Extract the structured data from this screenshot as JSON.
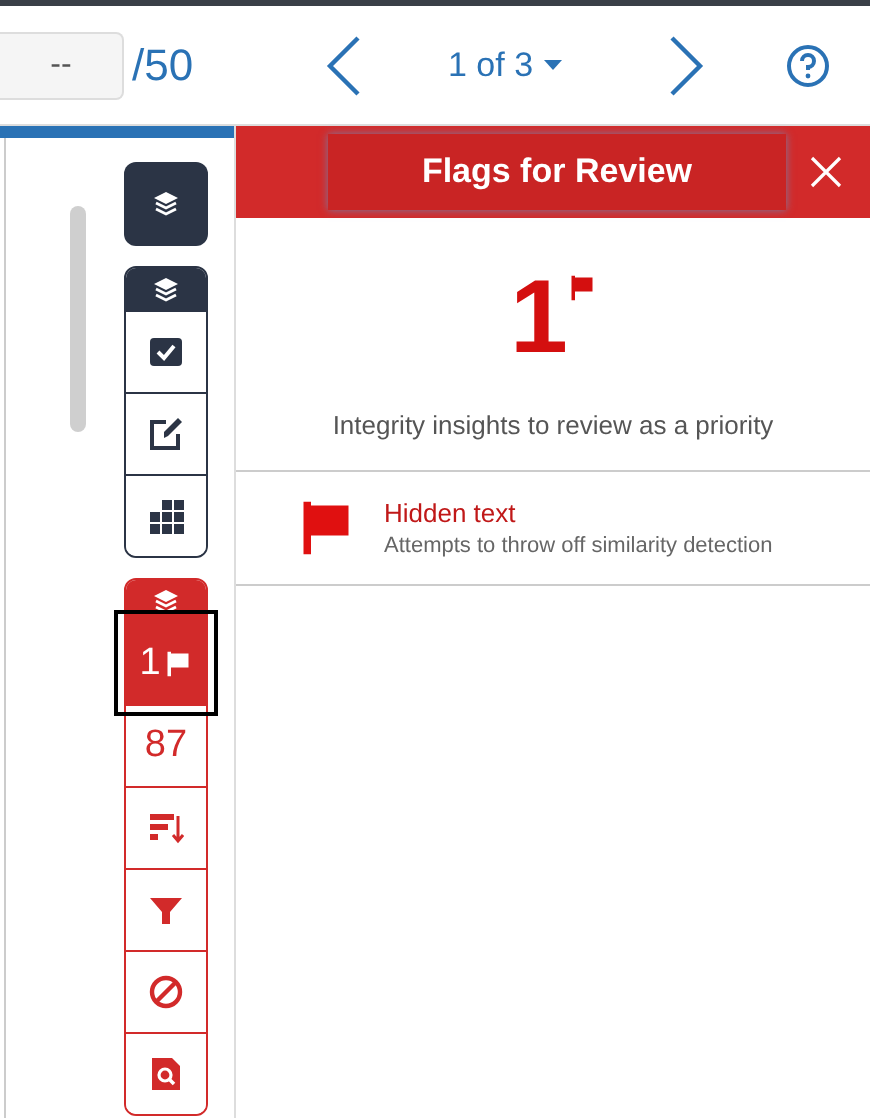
{
  "toolbar": {
    "page_field": {
      "value": "--"
    },
    "page_total": "/50",
    "pager": "1 of 3"
  },
  "rail": {
    "groups": [
      {
        "color": "#2b3445",
        "items": [
          {
            "kind": "check",
            "selected": false
          },
          {
            "kind": "edit",
            "selected": false
          },
          {
            "kind": "grid",
            "selected": false
          }
        ]
      },
      {
        "color": "#d22a2a",
        "items": [
          {
            "kind": "flags",
            "label": "1",
            "selected": true
          },
          {
            "kind": "count",
            "label": "87",
            "selected": false
          },
          {
            "kind": "sort",
            "selected": false
          },
          {
            "kind": "filter",
            "selected": false
          },
          {
            "kind": "ban",
            "selected": false
          },
          {
            "kind": "search",
            "selected": false
          }
        ]
      }
    ]
  },
  "panel": {
    "title": "Flags for Review",
    "count": "1",
    "subtitle": "Integrity insights to review as a priority",
    "flags": [
      {
        "title": "Hidden text",
        "description": "Attempts to throw off similarity detection"
      }
    ]
  }
}
